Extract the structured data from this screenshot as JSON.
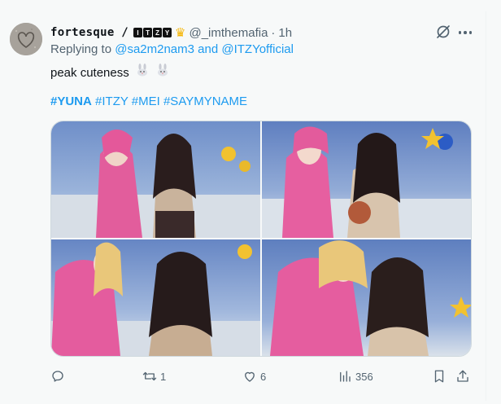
{
  "tweet": {
    "display_name": "fortesque /",
    "badges": [
      "I",
      "T",
      "Z",
      "Y"
    ],
    "handle": "@_imthemafia",
    "separator": "·",
    "time": "1h",
    "reply_prefix": "Replying to",
    "reply_to": "@sa2m2nam3 and @ITZYofficial",
    "text": "peak cuteness",
    "hashtags": {
      "tag1": "#YUNA",
      "tag2": "#ITZY",
      "tag3": "#MEI",
      "tag4": "#SAYMYNAME"
    }
  },
  "media": {
    "count": 4,
    "photos": [
      "photo-1",
      "photo-2",
      "photo-3",
      "photo-4"
    ]
  },
  "actions": {
    "reply_count": "",
    "retweet_count": "1",
    "like_count": "6",
    "views_count": "356"
  },
  "icons": {
    "avatar": "heart-sand-avatar",
    "grok": "grok-icon",
    "more": "more-icon",
    "reply": "reply-icon",
    "retweet": "retweet-icon",
    "like": "heart-icon",
    "views": "views-icon",
    "bookmark": "bookmark-icon",
    "share": "share-icon"
  },
  "colors": {
    "accent": "#1d9bf0",
    "text_primary": "#0f1419",
    "text_secondary": "#536471",
    "background": "#f7f9f9"
  }
}
